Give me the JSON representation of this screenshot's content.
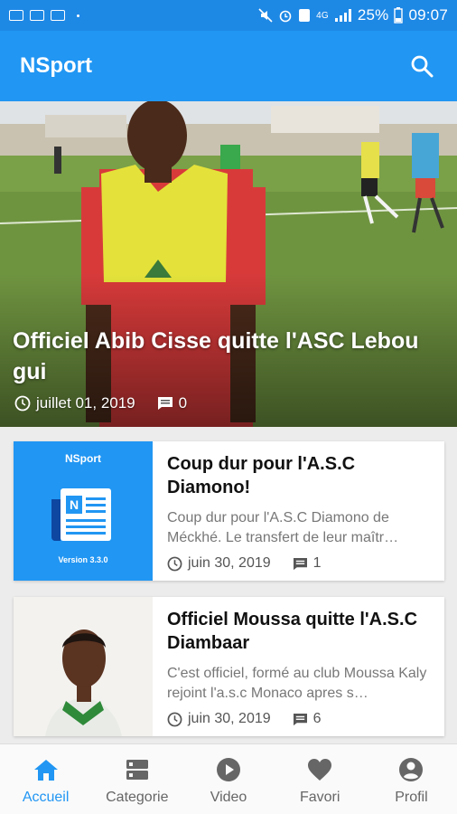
{
  "status_bar": {
    "battery": "25%",
    "time": "09:07",
    "network": "4G"
  },
  "app": {
    "title": "NSport"
  },
  "hero": {
    "title": "Officiel Abib Cisse quitte l'ASC Lebou gui",
    "date": "juillet 01, 2019",
    "comments": "0"
  },
  "articles": [
    {
      "title": "Coup dur pour l'A.S.C Diamono!",
      "excerpt": "Coup dur pour l'A.S.C Diamono de Méckhé. Le transfert de leur maîtr…",
      "date": "juin 30, 2019",
      "comments": "1",
      "thumb_title": "NSport",
      "thumb_version": "Version 3.3.0"
    },
    {
      "title": "Officiel Moussa quitte l'A.S.C Diambaar",
      "excerpt": "C'est officiel, formé au club Moussa Kaly rejoint l'a.s.c Monaco apres s…",
      "date": "juin 30, 2019",
      "comments": "6"
    }
  ],
  "bottom_nav": [
    {
      "label": "Accueil",
      "icon": "home-icon",
      "active": true
    },
    {
      "label": "Categorie",
      "icon": "category-icon",
      "active": false
    },
    {
      "label": "Video",
      "icon": "play-icon",
      "active": false
    },
    {
      "label": "Favori",
      "icon": "heart-icon",
      "active": false
    },
    {
      "label": "Profil",
      "icon": "profile-icon",
      "active": false
    }
  ],
  "colors": {
    "primary": "#2196f3",
    "status_bar": "#1e88e5",
    "nav_active": "#2196f3",
    "nav_inactive": "#666666"
  }
}
